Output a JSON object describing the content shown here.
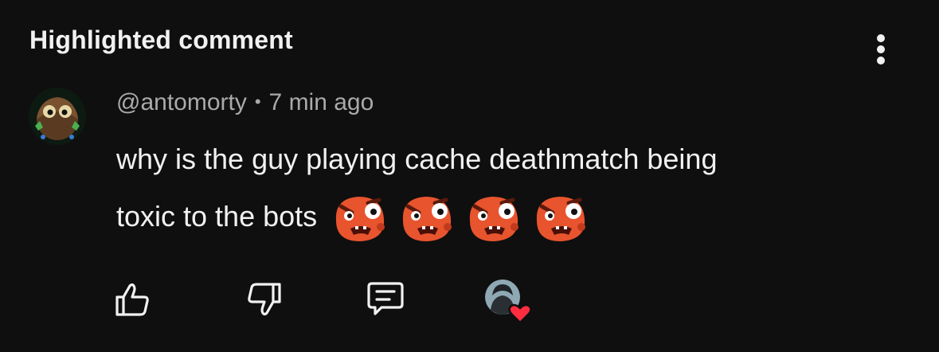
{
  "header": {
    "title": "Highlighted comment"
  },
  "comment": {
    "author": "@antomorty",
    "separator": "•",
    "timestamp": "7 min ago",
    "text_line1": "why is the guy playing cache deathmatch being",
    "text_line2": "toxic to the bots",
    "emojis": [
      "angry-face-emoji",
      "angry-face-emoji",
      "angry-face-emoji",
      "angry-face-emoji"
    ]
  },
  "actions": {
    "like_icon": "thumbs-up-icon",
    "dislike_icon": "thumbs-down-icon",
    "reply_icon": "reply-icon",
    "creator_heart_icon": "creator-heart-icon"
  },
  "colors": {
    "background": "#0f0f0f",
    "primary_text": "#f1f1f1",
    "secondary_text": "#aaaaaa",
    "emoji_orange": "#e8542e",
    "heart_red": "#ff2d3f"
  }
}
